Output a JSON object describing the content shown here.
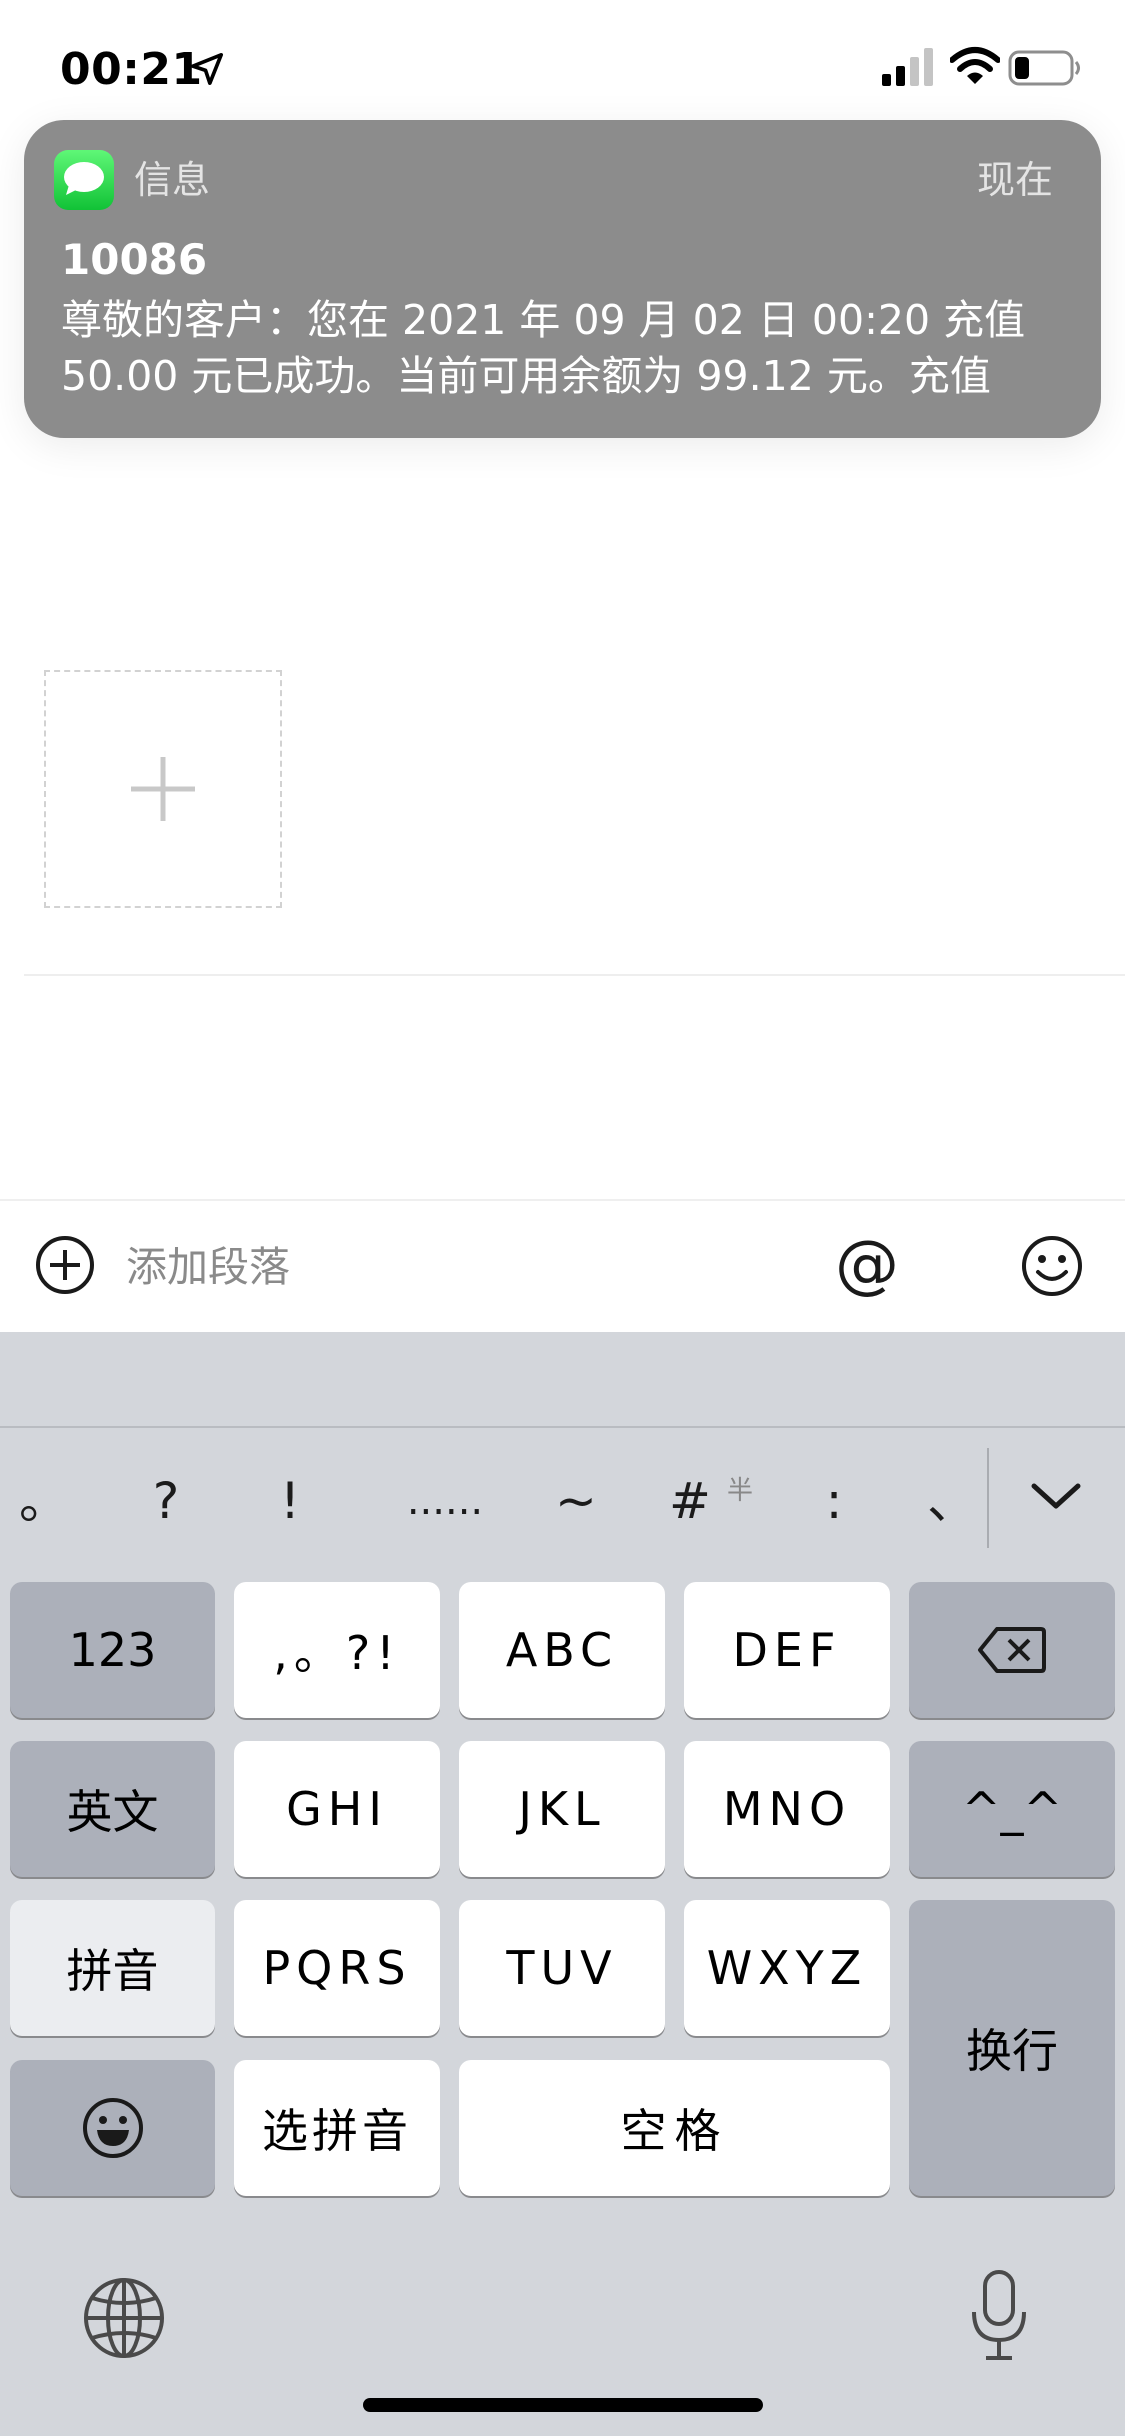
{
  "status_bar": {
    "time": "00:21"
  },
  "notification": {
    "app_name": "信息",
    "time": "现在",
    "sender": "10086",
    "body": "尊敬的客户：您在 2021 年 09 月 02 日 00:20 充值 50.00 元已成功。当前可用余额为 99.12 元。充值"
  },
  "editor": {
    "add_paragraph_label": "添加段落",
    "mention_symbol": "@"
  },
  "keyboard": {
    "candidates": [
      "。",
      "?",
      "!",
      "......",
      "~",
      "#",
      ":",
      "、"
    ],
    "half_width_label": "半",
    "rows": [
      [
        "123",
        ",。?!",
        "ABC",
        "DEF"
      ],
      [
        "英文",
        "GHI",
        "JKL",
        "MNO",
        "^_^"
      ],
      [
        "拼音",
        "PQRS",
        "TUV",
        "WXYZ",
        "换行"
      ],
      [
        "选拼音",
        "空格"
      ]
    ]
  },
  "colors": {
    "notification_bg": "#8c8c8c",
    "messages_icon_green": "#2fd34f",
    "keyboard_bg": "#d3d6db",
    "key_light": "#ffffff",
    "key_dark": "#acb0ba"
  }
}
